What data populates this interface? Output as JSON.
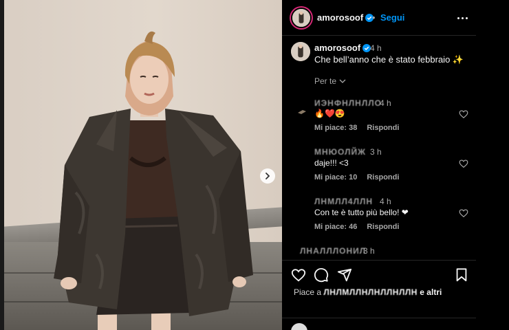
{
  "post": {
    "username": "amorosoof",
    "follow_label": "Segui",
    "separator": "•"
  },
  "caption": {
    "username": "amorosoof",
    "time": "4 h",
    "text": "Che bell’anno che è stato febbraio ✨"
  },
  "see_translation": "Per te",
  "comments": [
    {
      "username": "ИЭНФНЛНЛЛО",
      "time": "4 h",
      "text": "🔥❤️😍",
      "likes": "Mi piace: 38",
      "reply": "Rispondi"
    },
    {
      "username": "МНЮОЛЙЖ",
      "time": "3 h",
      "text": "daje!!! <3",
      "likes": "Mi piace: 10",
      "reply": "Rispondi"
    },
    {
      "username": "ЛНМЛЛ4ЛЛН",
      "time": "4 h",
      "text": "Con te è tutto più bello! ❤",
      "likes": "Mi piace: 46",
      "reply": "Rispondi"
    },
    {
      "username": "ЛНАЛЛЛОНИЛ",
      "time": "3 h"
    }
  ],
  "likes_line": {
    "prefix": "Piace a ",
    "blurred": "ЛНЛМЛЛНЛНЛЛНЛЛН",
    "suffix": " e altri"
  },
  "colors": {
    "accent": "#0095f6",
    "verified": "#0095f6",
    "ring": "#d62976"
  }
}
